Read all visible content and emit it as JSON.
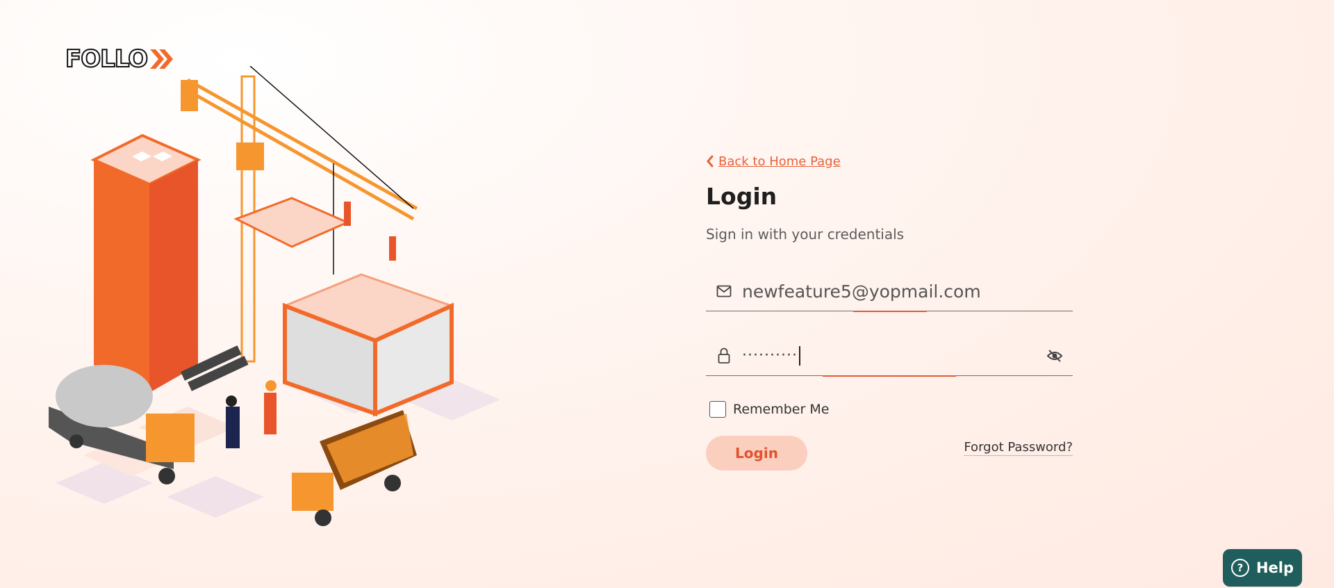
{
  "brand": {
    "logo_text": "FOLLO",
    "accent_color": "#f26a2a"
  },
  "back_link": {
    "label": "Back to Home Page",
    "icon": "chevron-left-icon"
  },
  "login": {
    "title": "Login",
    "subtitle": "Sign in with your credentials"
  },
  "email_field": {
    "value": "newfeature5@yopmail.com",
    "icon": "mail-icon"
  },
  "password_field": {
    "value": "··········",
    "icon": "lock-icon",
    "toggle_icon": "eye-off-icon"
  },
  "remember_me": {
    "label": "Remember Me",
    "checked": false
  },
  "actions": {
    "login_label": "Login",
    "forgot_label": "Forgot Password?"
  },
  "help": {
    "label": "Help",
    "icon": "question-circle-icon"
  },
  "colors": {
    "primary": "#e8613a",
    "button_bg": "#fbcfbe",
    "help_bg": "#1f5e5c"
  }
}
